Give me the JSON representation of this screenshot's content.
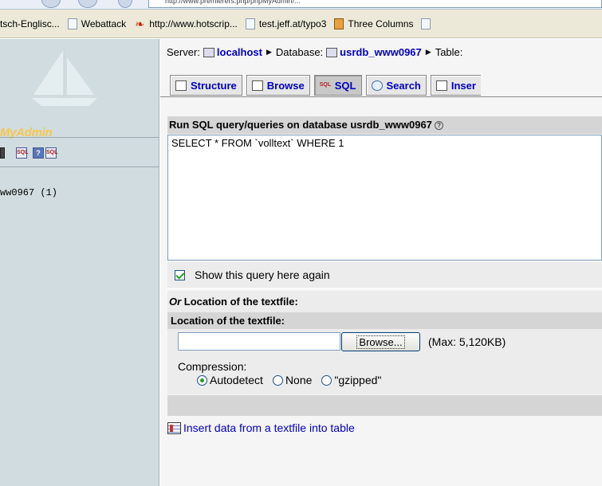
{
  "browser": {
    "address_fragment": "http://www.premierers.php/phpMyAdmin/...",
    "bookmarks": [
      {
        "label": "tsch-Englisc...",
        "icon": "none"
      },
      {
        "label": "Webattack",
        "icon": "page-icon"
      },
      {
        "label": "http://www.hotscrip...",
        "icon": "flame-icon"
      },
      {
        "label": "test.jeff.at/typo3",
        "icon": "page-icon"
      },
      {
        "label": "Three Columns",
        "icon": "box-icon"
      }
    ]
  },
  "sidebar": {
    "logo_text": "MyAdmin",
    "database_item": "ww0967 (1)"
  },
  "breadcrumb": {
    "server_label": "Server:",
    "server_value": "localhost",
    "database_label": "Database:",
    "database_value": "usrdb_www0967",
    "table_label": "Table:"
  },
  "tabs": [
    {
      "label": "Structure",
      "icon": "structure-icon",
      "active": false
    },
    {
      "label": "Browse",
      "icon": "browse-icon",
      "active": false
    },
    {
      "label": "SQL",
      "icon": "sql-icon",
      "active": true
    },
    {
      "label": "Search",
      "icon": "search-icon",
      "active": false
    },
    {
      "label": "Inser",
      "icon": "insert-icon",
      "active": false
    }
  ],
  "sql_panel": {
    "title": "Run SQL query/queries on database usrdb_www0967",
    "query_text": "SELECT * FROM `volltext` WHERE 1",
    "show_query_label": "Show this query here again",
    "show_query_checked": true
  },
  "textfile": {
    "or_prefix": "Or",
    "heading_suffix": "Location of the textfile:",
    "subheading": "Location of the textfile:",
    "file_value": "",
    "browse_label": "Browse...",
    "max_size": "(Max: 5,120KB)",
    "compression_label": "Compression:",
    "compression_options": [
      "Autodetect",
      "None",
      "\"gzipped\""
    ],
    "compression_selected": "Autodetect"
  },
  "insert_link": "Insert data from a textfile into table",
  "colors": {
    "link_blue": "#0000c0",
    "sidebar_bg": "#d0dce0",
    "header_gray": "#d5d5d5",
    "logo_orange": "#f7c64b"
  }
}
